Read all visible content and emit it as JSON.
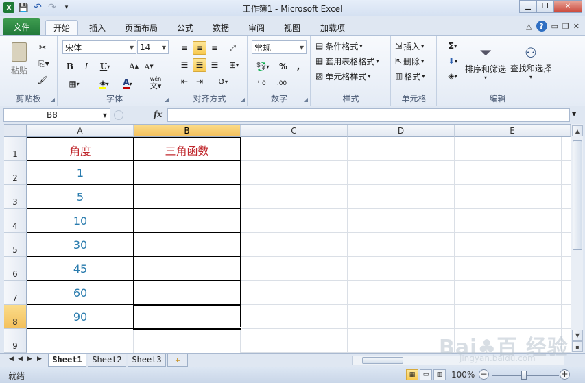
{
  "window": {
    "title": "工作簿1 - Microsoft Excel"
  },
  "qat": {
    "logo": "X",
    "save": "💾",
    "undo": "↶",
    "redo": "↷",
    "customize": "▾"
  },
  "tabs": {
    "file": "文件",
    "items": [
      "开始",
      "插入",
      "页面布局",
      "公式",
      "数据",
      "审阅",
      "视图",
      "加载项"
    ],
    "active": "开始"
  },
  "ribbon": {
    "clipboard": {
      "label": "剪贴板",
      "paste": "粘贴"
    },
    "font": {
      "label": "字体",
      "name": "宋体",
      "size": "14",
      "bold": "B",
      "italic": "I",
      "underline": "U",
      "grow": "A",
      "shrink": "A",
      "wen": "wén"
    },
    "alignment": {
      "label": "对齐方式"
    },
    "number": {
      "label": "数字",
      "format": "常规",
      "percent": "%",
      "comma": ","
    },
    "styles": {
      "label": "样式",
      "conditional": "条件格式",
      "table": "套用表格格式",
      "cell_styles": "单元格样式"
    },
    "cells": {
      "label": "单元格",
      "insert": "插入",
      "delete": "删除",
      "format": "格式"
    },
    "editing": {
      "label": "编辑",
      "sigma": "Σ",
      "sort_filter": "排序和筛选",
      "find_select": "查找和选择"
    }
  },
  "formula_bar": {
    "name_box": "B8",
    "fx": "fx",
    "value": ""
  },
  "sheet": {
    "columns": [
      "A",
      "B",
      "C",
      "D",
      "E"
    ],
    "selected_column": "B",
    "rows": [
      "1",
      "2",
      "3",
      "4",
      "5",
      "6",
      "7",
      "8",
      "9"
    ],
    "selected_row": "8",
    "cells": {
      "A1": "角度",
      "B1": "三角函数",
      "A2": "1",
      "A3": "5",
      "A4": "10",
      "A5": "30",
      "A6": "45",
      "A7": "60",
      "A8": "90"
    }
  },
  "sheet_tabs": [
    "Sheet1",
    "Sheet2",
    "Sheet3"
  ],
  "active_sheet": "Sheet1",
  "status": {
    "text": "就绪",
    "zoom": "100%"
  },
  "watermark": {
    "main": "Bai♣百 经验",
    "sub": "jingyan.baidu.com"
  },
  "colors": {
    "file_tab": "#21793a",
    "header_text": "#c0282d",
    "number_text": "#2a7cae",
    "selected_header": "#f3c05c"
  }
}
